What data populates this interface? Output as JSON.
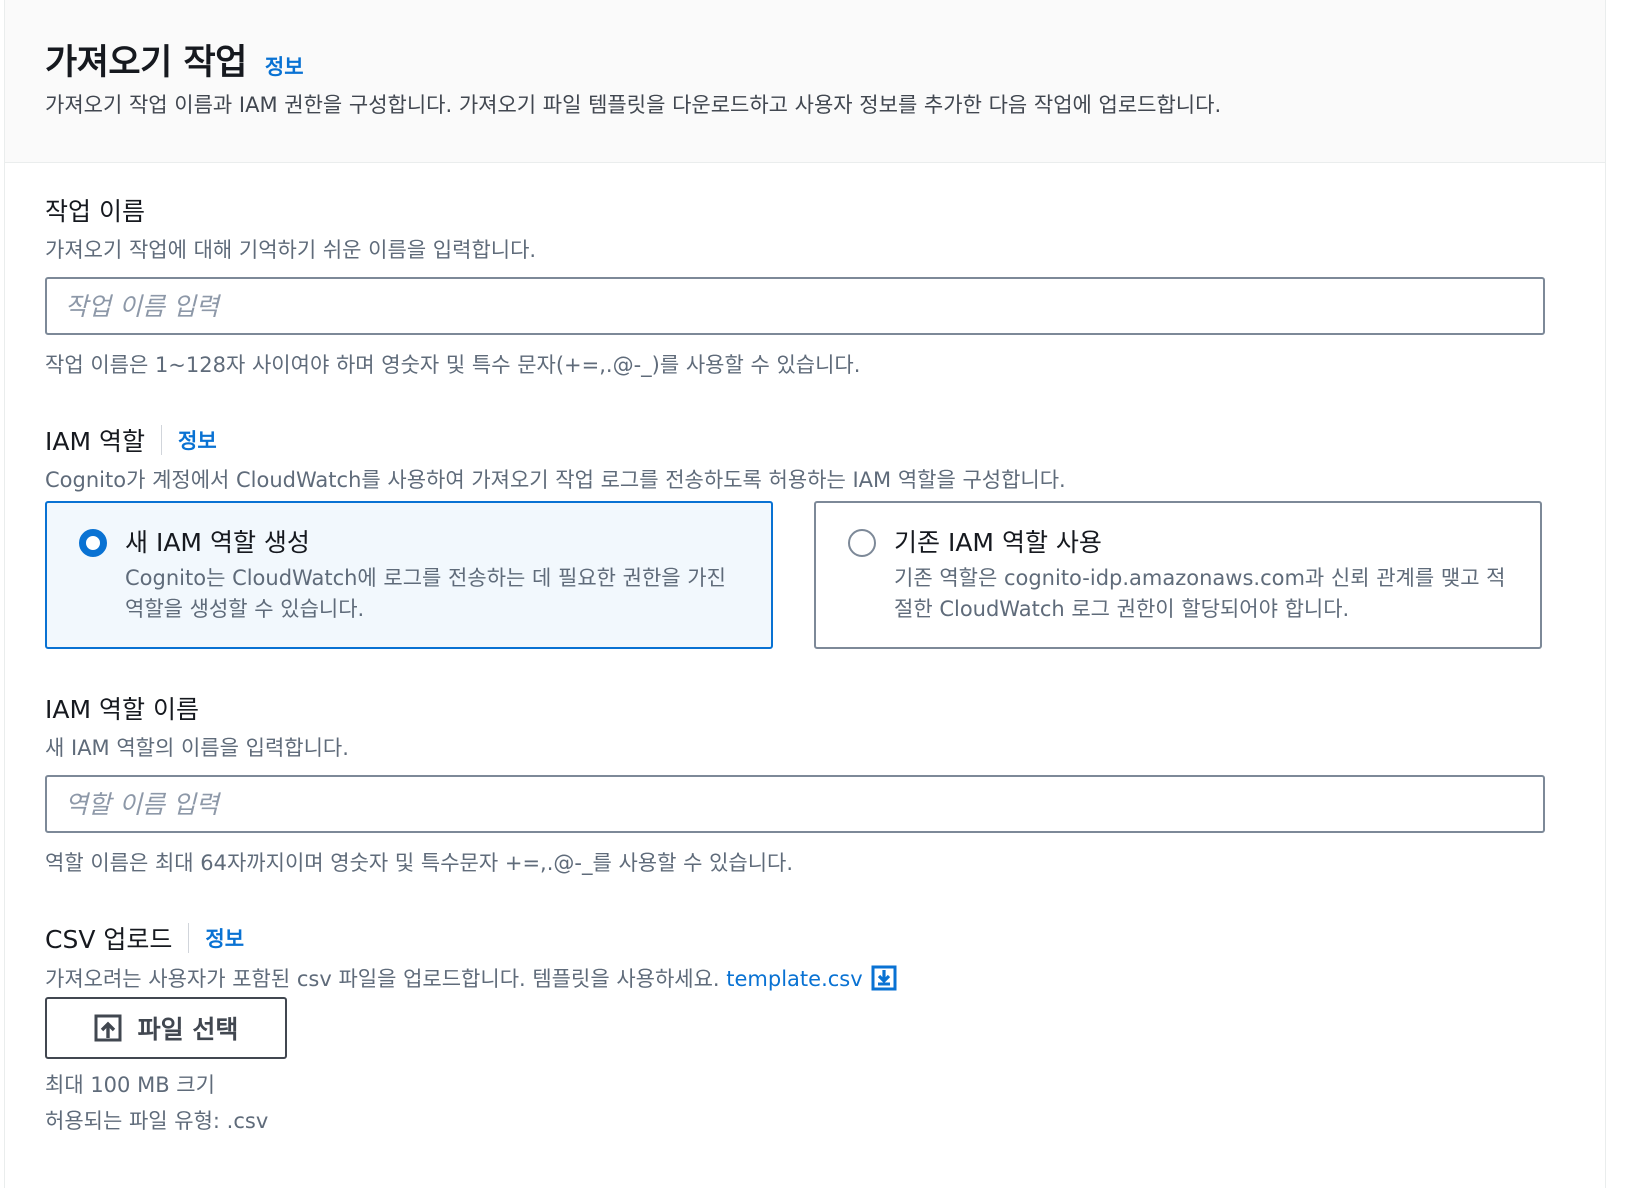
{
  "header": {
    "title": "가져오기 작업",
    "info_label": "정보",
    "description": "가져오기 작업 이름과 IAM 권한을 구성합니다. 가져오기 파일 템플릿을 다운로드하고 사용자 정보를 추가한 다음 작업에 업로드합니다."
  },
  "job_name": {
    "label": "작업 이름",
    "description": "가져오기 작업에 대해 기억하기 쉬운 이름을 입력합니다.",
    "value": "",
    "placeholder": "작업 이름 입력",
    "constraint": "작업 이름은 1~128자 사이여야 하며 영숫자 및 특수 문자(+=,.@-_)를 사용할 수 있습니다."
  },
  "iam_role": {
    "label": "IAM 역할",
    "info_label": "정보",
    "description": "Cognito가 계정에서 CloudWatch를 사용하여 가져오기 작업 로그를 전송하도록 허용하는 IAM 역할을 구성합니다.",
    "options": [
      {
        "title": "새 IAM 역할 생성",
        "description": "Cognito는 CloudWatch에 로그를 전송하는 데 필요한 권한을 가진 역할을 생성할 수 있습니다.",
        "selected": true
      },
      {
        "title": "기존 IAM 역할 사용",
        "description": "기존 역할은 cognito-idp.amazonaws.com과 신뢰 관계를 맺고 적절한 CloudWatch 로그 권한이 할당되어야 합니다.",
        "selected": false
      }
    ]
  },
  "iam_role_name": {
    "label": "IAM 역할 이름",
    "description": "새 IAM 역할의 이름을 입력합니다.",
    "value": "",
    "placeholder": "역할 이름 입력",
    "constraint": "역할 이름은 최대 64자까지이며 영숫자 및 특수문자 +=,.@-_를 사용할 수 있습니다."
  },
  "csv_upload": {
    "label": "CSV 업로드",
    "info_label": "정보",
    "description": "가져오려는 사용자가 포함된 csv 파일을 업로드합니다. 템플릿을 사용하세요.",
    "template_link": "template.csv",
    "button_label": "파일 선택",
    "max_size": "최대 100 MB 크기",
    "allowed_types": "허용되는 파일 유형: .csv"
  },
  "colors": {
    "accent": "#0972d3",
    "selected_tile_bg": "#f2f8fd",
    "header_bg": "#fafafa"
  },
  "icons": {
    "download": "download-icon",
    "upload": "upload-icon"
  }
}
